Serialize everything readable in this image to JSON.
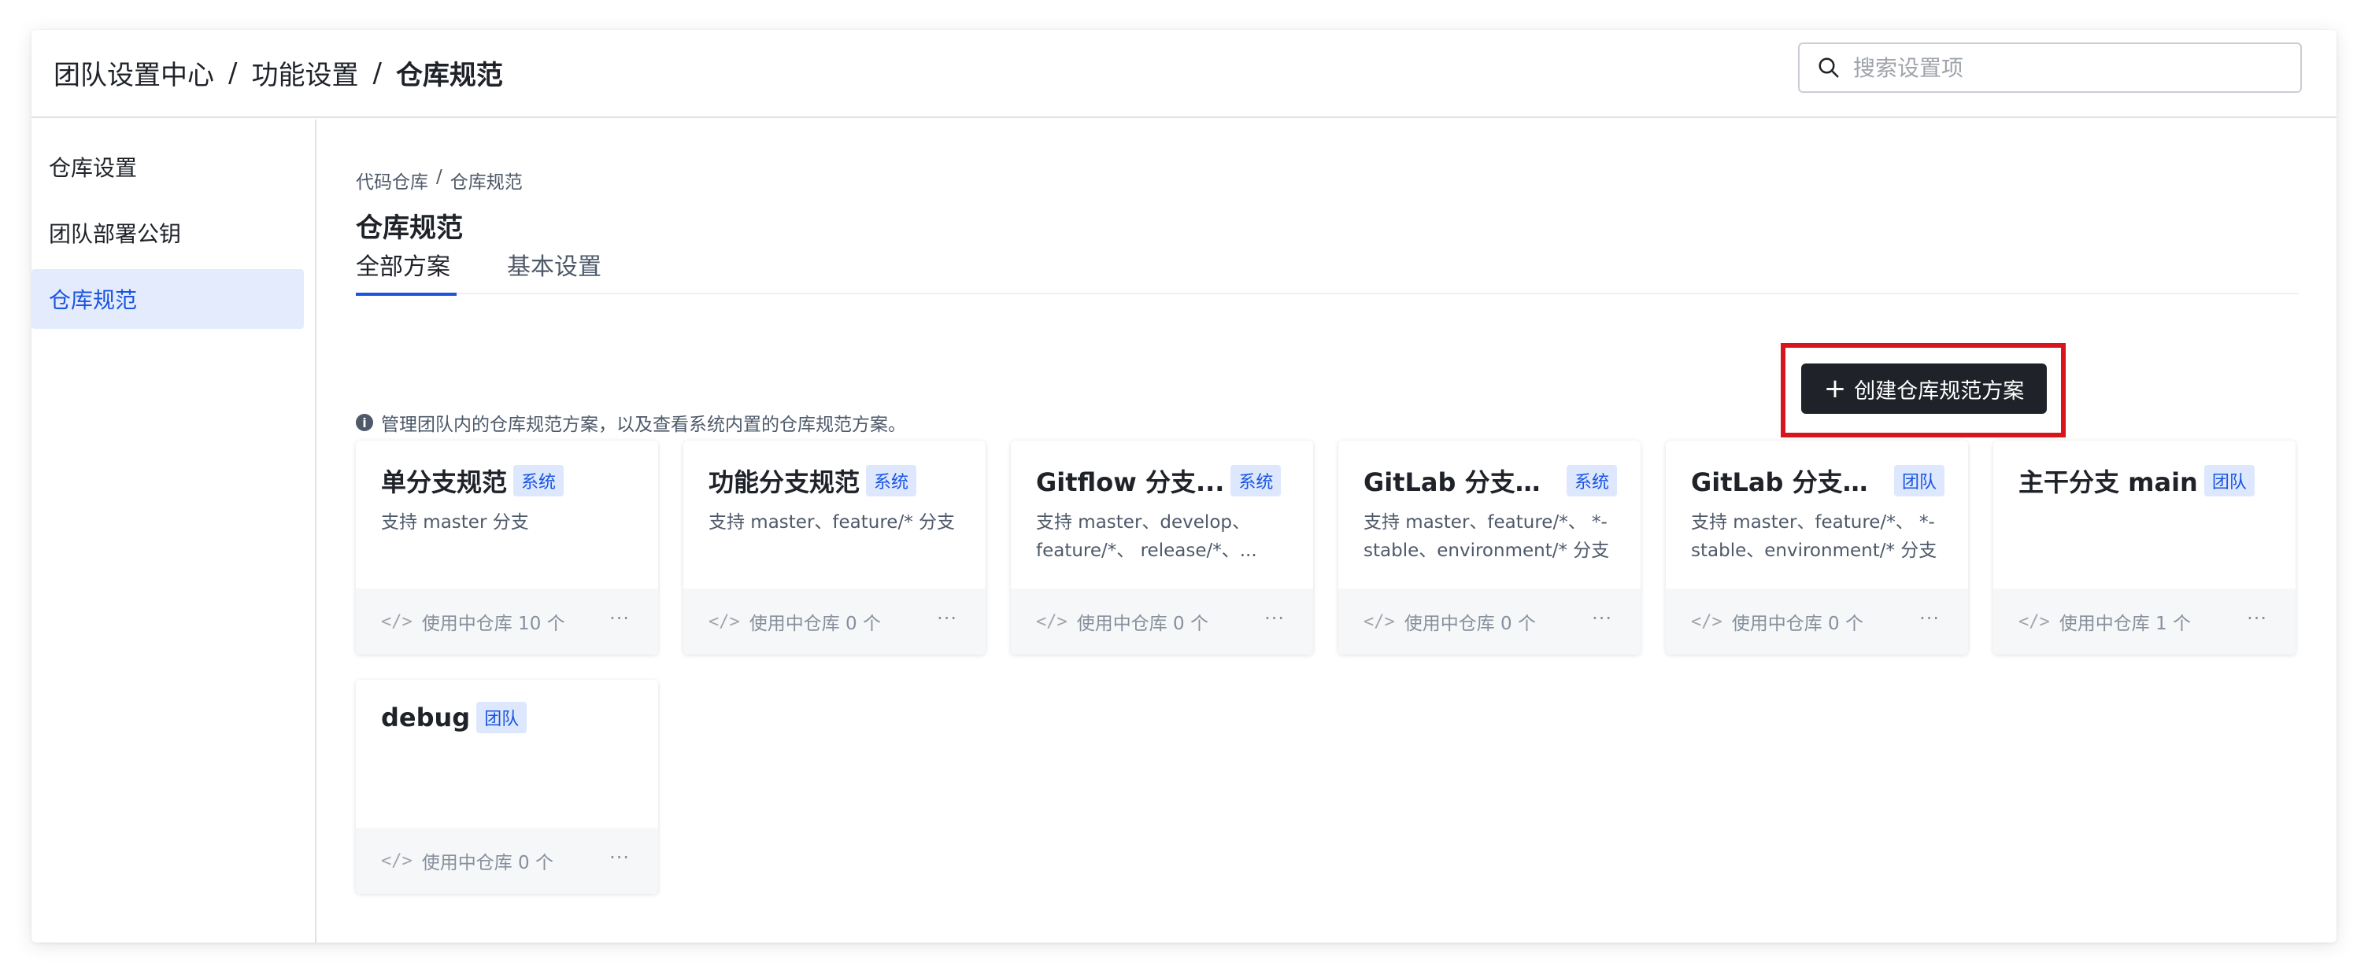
{
  "header": {
    "breadcrumb": [
      "团队设置中心",
      "功能设置",
      "仓库规范"
    ],
    "search_placeholder": "搜索设置项"
  },
  "sidebar": {
    "items": [
      {
        "label": "仓库设置",
        "active": false
      },
      {
        "label": "团队部署公钥",
        "active": false
      },
      {
        "label": "仓库规范",
        "active": true
      }
    ]
  },
  "main": {
    "breadcrumb": [
      "代码仓库",
      "仓库规范"
    ],
    "title": "仓库规范",
    "tabs": [
      {
        "label": "全部方案",
        "active": true
      },
      {
        "label": "基本设置",
        "active": false
      }
    ],
    "info_text": "管理团队内的仓库规范方案，以及查看系统内置的仓库规范方案。",
    "create_button": {
      "plus": "+",
      "label": "创建仓库规范方案"
    },
    "cards": [
      {
        "title": "单分支规范",
        "badge": "系统",
        "desc": "支持 master 分支",
        "usage": "使用中仓库 10 个"
      },
      {
        "title": "功能分支规范",
        "badge": "系统",
        "desc": "支持 master、feature/* 分支",
        "usage": "使用中仓库 0 个"
      },
      {
        "title": "Gitflow 分支...",
        "badge": "系统",
        "desc": "支持 master、develop、feature/*、 release/*、...",
        "usage": "使用中仓库 0 个"
      },
      {
        "title": "GitLab 分支规范",
        "badge": "系统",
        "desc": "支持 master、feature/*、 *-stable、environment/* 分支",
        "usage": "使用中仓库 0 个"
      },
      {
        "title": "GitLab 分支规...",
        "badge": "团队",
        "desc": "支持 master、feature/*、 *-stable、environment/* 分支",
        "usage": "使用中仓库 0 个"
      },
      {
        "title": "主干分支 main",
        "badge": "团队",
        "desc": "",
        "usage": "使用中仓库 1 个"
      },
      {
        "title": "debug",
        "badge": "团队",
        "desc": "",
        "usage": "使用中仓库 0 个"
      }
    ],
    "more_label": "···",
    "code_icon": "</>"
  }
}
